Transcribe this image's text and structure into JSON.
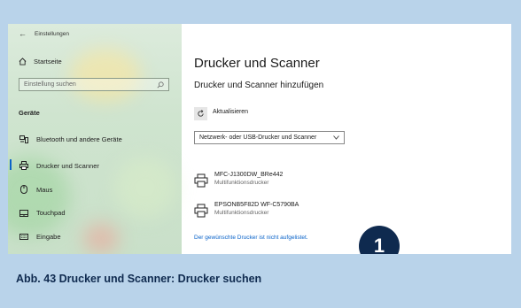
{
  "sidebar": {
    "back_title": "Einstellungen",
    "home": "Startseite",
    "search_placeholder": "Einstellung suchen",
    "section": "Geräte",
    "items": [
      {
        "label": "Bluetooth und andere Geräte",
        "icon": "bluetooth-devices-icon"
      },
      {
        "label": "Drucker und Scanner",
        "icon": "printer-icon",
        "active": true
      },
      {
        "label": "Maus",
        "icon": "mouse-icon"
      },
      {
        "label": "Touchpad",
        "icon": "touchpad-icon"
      },
      {
        "label": "Eingabe",
        "icon": "keyboard-icon"
      }
    ]
  },
  "main": {
    "title": "Drucker und Scanner",
    "subtitle": "Drucker und Scanner hinzufügen",
    "refresh_label": "Aktualisieren",
    "dropdown_value": "Netzwerk- oder USB-Drucker und Scanner",
    "printers": [
      {
        "name": "MFC-J1300DW_BRe442",
        "type": "Multifunktionsdrucker"
      },
      {
        "name": "EPSONB5F82D WF-C5790BA",
        "type": "Multifunktionsdrucker"
      }
    ],
    "not_listed_link": "Der gewünschte Drucker ist nicht aufgelistet."
  },
  "badge": "1",
  "caption": "Abb. 43  Drucker und Scanner: Drucker suchen",
  "colors": {
    "accent": "#0a63c9",
    "badge": "#0f2a4f",
    "page_bg": "#b9d3ea"
  }
}
